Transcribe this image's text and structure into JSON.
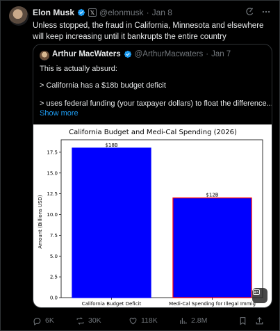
{
  "tweet": {
    "author_name": "Elon Musk",
    "author_handle": "@elonmusk",
    "date": "Jan 8",
    "separator": "·",
    "text": "Unless stopped, the fraud in California, Minnesota and elsewhere will keep increasing until it bankrupts the entire country"
  },
  "quote": {
    "author_name": "Arthur MacWaters",
    "author_handle": "@ArthurMacwaters",
    "separator": "·",
    "date": "Jan 7",
    "lines": [
      "This is actually absurd:",
      "> California has a $18b budget deficit",
      "> uses federal funding (your taxpayer dollars) to float the difference..."
    ],
    "show_more": "Show more"
  },
  "chart_data": {
    "type": "bar",
    "title": "California Budget and Medi-Cal Spending (2026)",
    "ylabel": "Amount (Billions USD)",
    "xlabel": "",
    "categories": [
      "California Budget Deficit",
      "Medi-Cal Spending for Illegal Immig"
    ],
    "values": [
      18,
      12
    ],
    "data_labels": [
      "$18B",
      "$12B"
    ],
    "ylim": [
      0,
      19
    ],
    "yticks": [
      "0.0",
      "2.5",
      "5.0",
      "7.5",
      "10.0",
      "12.5",
      "15.0",
      "17.5"
    ],
    "ytick_values": [
      0,
      2.5,
      5,
      7.5,
      10,
      12.5,
      15,
      17.5
    ],
    "bar_colors": [
      "#0000ff",
      "#0000ff"
    ],
    "bar_edges": [
      "#0000ff",
      "#ff0000"
    ],
    "grid": false
  },
  "actions": {
    "replies": "6K",
    "reposts": "30K",
    "likes": "118K",
    "views": "2.8M"
  },
  "colors": {
    "accent": "#1d9bf0",
    "muted": "#71767b",
    "border": "#2f3336"
  }
}
